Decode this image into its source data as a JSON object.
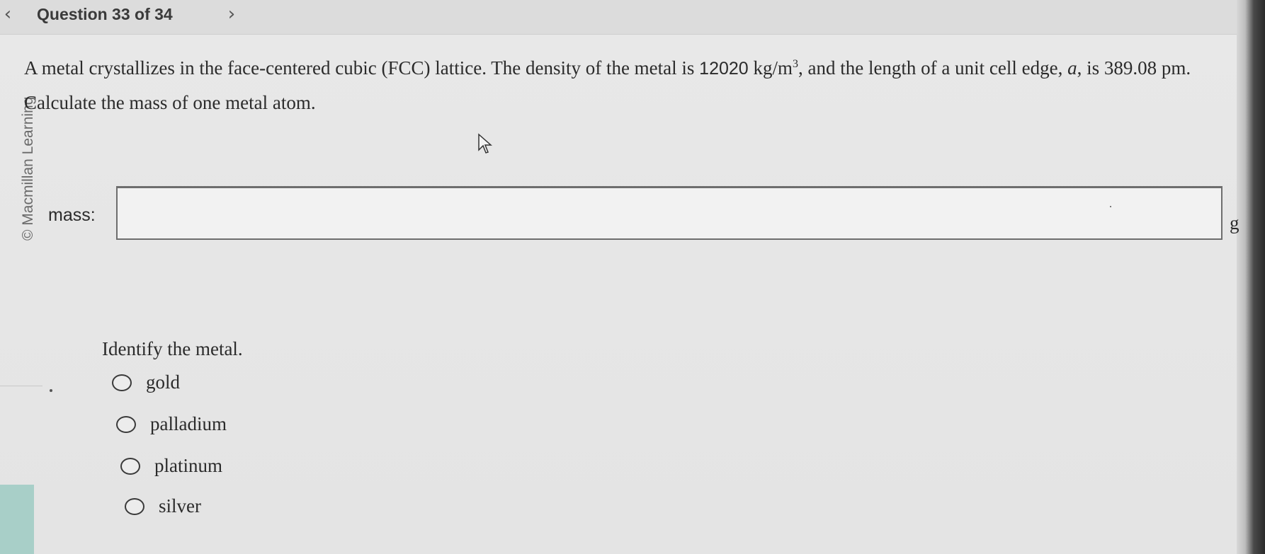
{
  "nav": {
    "prev_icon": "chevron-left-icon",
    "prev_glyph": "‹",
    "next_icon": "chevron-right-icon",
    "next_glyph": "›",
    "counter": "Question 33 of 34"
  },
  "sidebar": {
    "copyright": "© Macmillan Learning"
  },
  "question": {
    "part1": "A metal crystallizes in the face-centered cubic (FCC) lattice. The density of the metal is ",
    "density_value": "12020",
    "density_unit": "kg/m",
    "density_exp": "3",
    "part2": ", and the length of a unit cell edge, ",
    "edge_symbol": "a",
    "part3": ", is 389.08 pm. Calculate the mass of one metal atom."
  },
  "mass_field": {
    "label": "mass:",
    "value": "",
    "placeholder": "",
    "unit": "g"
  },
  "identify": {
    "prompt": "Identify the metal.",
    "options": [
      {
        "label": "gold",
        "selected": false
      },
      {
        "label": "palladium",
        "selected": false
      },
      {
        "label": "platinum",
        "selected": false
      },
      {
        "label": "silver",
        "selected": false
      }
    ]
  },
  "colors": {
    "background": "#e6e6e6",
    "text": "#2b2b2b",
    "accent_strip": "#a8cfc8"
  }
}
